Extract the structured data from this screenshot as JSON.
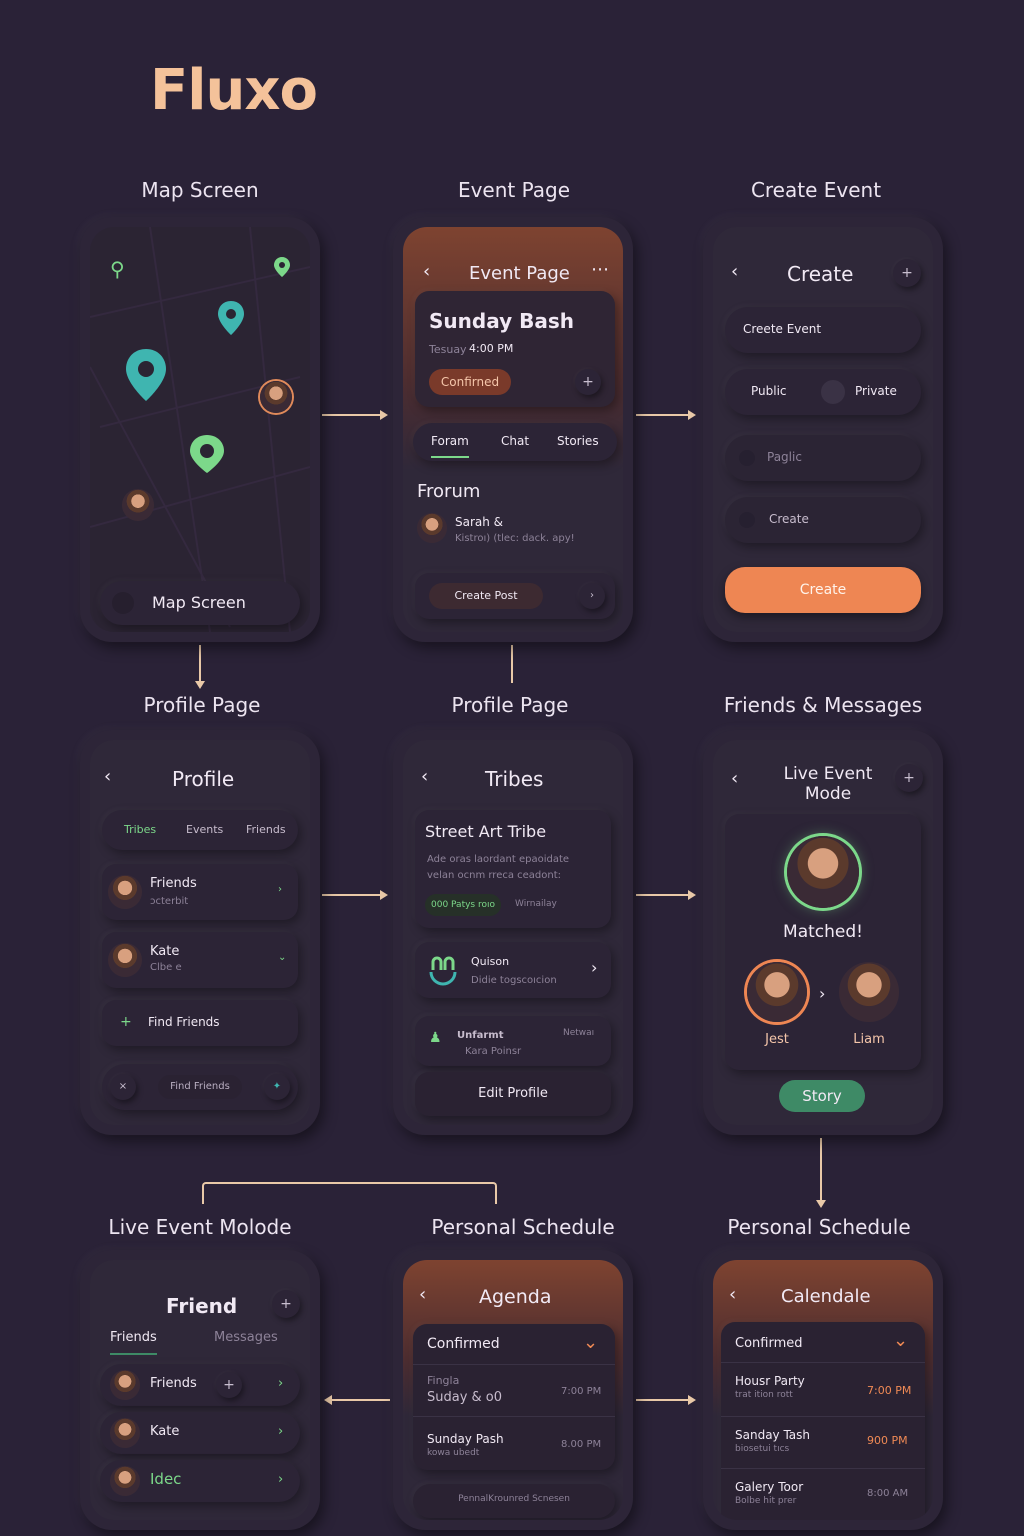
{
  "brand": {
    "logo": "Fluxo"
  },
  "labels": {
    "map": "Map Screen",
    "event": "Event Page",
    "create": "Create Event",
    "profile1": "Profile Page",
    "profile2": "Profile Page",
    "friends_msgs": "Friends & Messages",
    "live": "Live Event Molode",
    "sched1": "Personal Schedule",
    "sched2": "Personal Schedule"
  },
  "map": {
    "bottom_label": "Map Screen"
  },
  "event": {
    "title": "Event Page",
    "name": "Sunday Bash",
    "day": "Tesuay",
    "time": "4:00 PM",
    "status": "Confirned",
    "tabs": [
      "Foram",
      "Chat",
      "Stories"
    ],
    "section": "Frorum",
    "author": "Sarah &",
    "post": "Kistroı) (tlec: dack. apy!",
    "create_post": "Create Post"
  },
  "create": {
    "title": "Create",
    "field1": "Creete Event",
    "public": "Public",
    "private": "Private",
    "field3": "Paglic",
    "field4": "Create",
    "submit": "Create"
  },
  "profile": {
    "title": "Profile",
    "tabs": [
      "Tribes",
      "Events",
      "Friends"
    ],
    "item1_name": "Friends",
    "item1_sub": "ɔcterbit",
    "item2_name": "Kate",
    "item2_sub": "Clbe e",
    "find": "Find Friends",
    "find2": "Find Friends"
  },
  "tribes": {
    "title": "Tribes",
    "tribe_name": "Street Art Tribe",
    "desc1": "Ade oras laordant epaoidate",
    "desc2": "velan ocnm rreca ceadont:",
    "badge": "000 Patys roıo",
    "badge2": "Wirnailay",
    "q_name": "Quison",
    "q_sub": "Didie togscoıcion",
    "u_name": "Unfarmt",
    "u_sub": "Kara Poinsr",
    "u_tag": "Netwaı",
    "edit": "Edit Profile"
  },
  "live": {
    "title_l1": "Live Event",
    "title_l2": "Mode",
    "matched": "Matched!",
    "p1": "Jest",
    "p2": "Liam",
    "story": "Story"
  },
  "friend": {
    "title": "Friend",
    "tab1": "Friends",
    "tab2": "Messages",
    "r1": "Friends",
    "r2": "Kate",
    "r3": "Idec"
  },
  "agenda": {
    "title": "Agenda",
    "header": "Confirmed",
    "e1_l1": "Fingla",
    "e1_l2": "Suday & o0",
    "e1_time": "7:00 PM",
    "e2_l1": "Sunday Pash",
    "e2_l2": "kowa ubedt",
    "e2_time": "8.00 PM",
    "footer": "PennalKrounred Scnesen"
  },
  "calendar": {
    "title": "Calendale",
    "header": "Confirmed",
    "e1": "Housr Party",
    "e1_sub": "trat ition rott",
    "e1_time": "7:00 PM",
    "e2": "Sanday Tash",
    "e2_sub": "biosetui tıcs",
    "e2_time": "900 PM",
    "e3": "Galery Toor",
    "e3_sub": "Bolbe hit prer",
    "e3_time": "8:00 AM"
  },
  "colors": {
    "bg": "#2a2237",
    "accent": "#ee8653",
    "green": "#7cd88a",
    "teal": "#3fb5b0"
  }
}
